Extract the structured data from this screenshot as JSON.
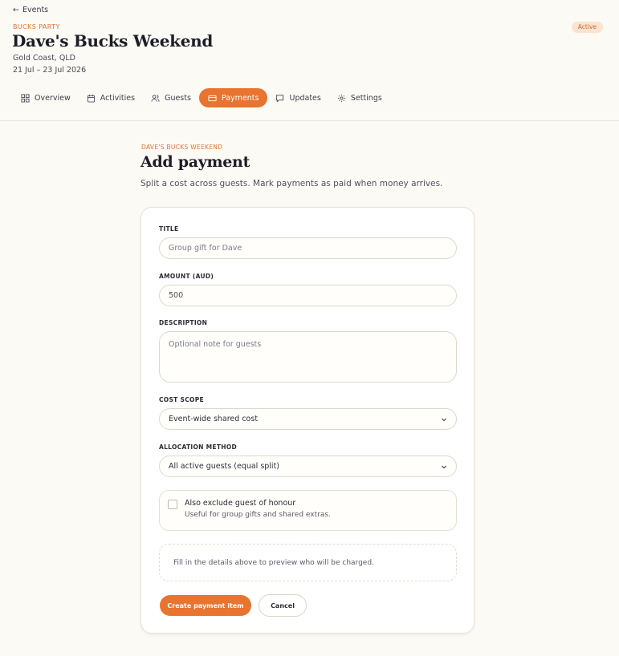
{
  "header": {
    "back_label": "Events",
    "eyebrow": "BUCKS PARTY",
    "title": "Dave's Bucks Weekend",
    "location": "Gold Coast, QLD",
    "dates": "21 Jul – 23 Jul 2026",
    "status": "Active"
  },
  "tabs": [
    {
      "label": "Overview",
      "icon": "grid-icon"
    },
    {
      "label": "Activities",
      "icon": "calendar-icon"
    },
    {
      "label": "Guests",
      "icon": "users-icon"
    },
    {
      "label": "Payments",
      "icon": "card-icon",
      "active": true
    },
    {
      "label": "Updates",
      "icon": "chat-icon"
    },
    {
      "label": "Settings",
      "icon": "gear-icon"
    }
  ],
  "main": {
    "eyebrow": "DAVE'S BUCKS WEEKEND",
    "title": "Add payment",
    "subtitle": "Split a cost across guests. Mark payments as paid when money arrives."
  },
  "form": {
    "title_label": "TITLE",
    "title_placeholder": "Group gift for Dave",
    "amount_label": "AMOUNT (AUD)",
    "amount_value": "500",
    "description_label": "DESCRIPTION",
    "description_placeholder": "Optional note for guests",
    "cost_scope_label": "COST SCOPE",
    "cost_scope_value": "Event-wide shared cost",
    "allocation_label": "ALLOCATION METHOD",
    "allocation_value": "All active guests (equal split)",
    "exclude_title": "Also exclude guest of honour",
    "exclude_hint": "Useful for group gifts and shared extras.",
    "exclude_checked": false,
    "preview_text": "Fill in the details above to preview who will be charged.",
    "submit_label": "Create payment item",
    "cancel_label": "Cancel"
  },
  "colors": {
    "accent": "#e8742f",
    "background": "#fbfaf5",
    "badge_bg": "#fbe3d1"
  }
}
